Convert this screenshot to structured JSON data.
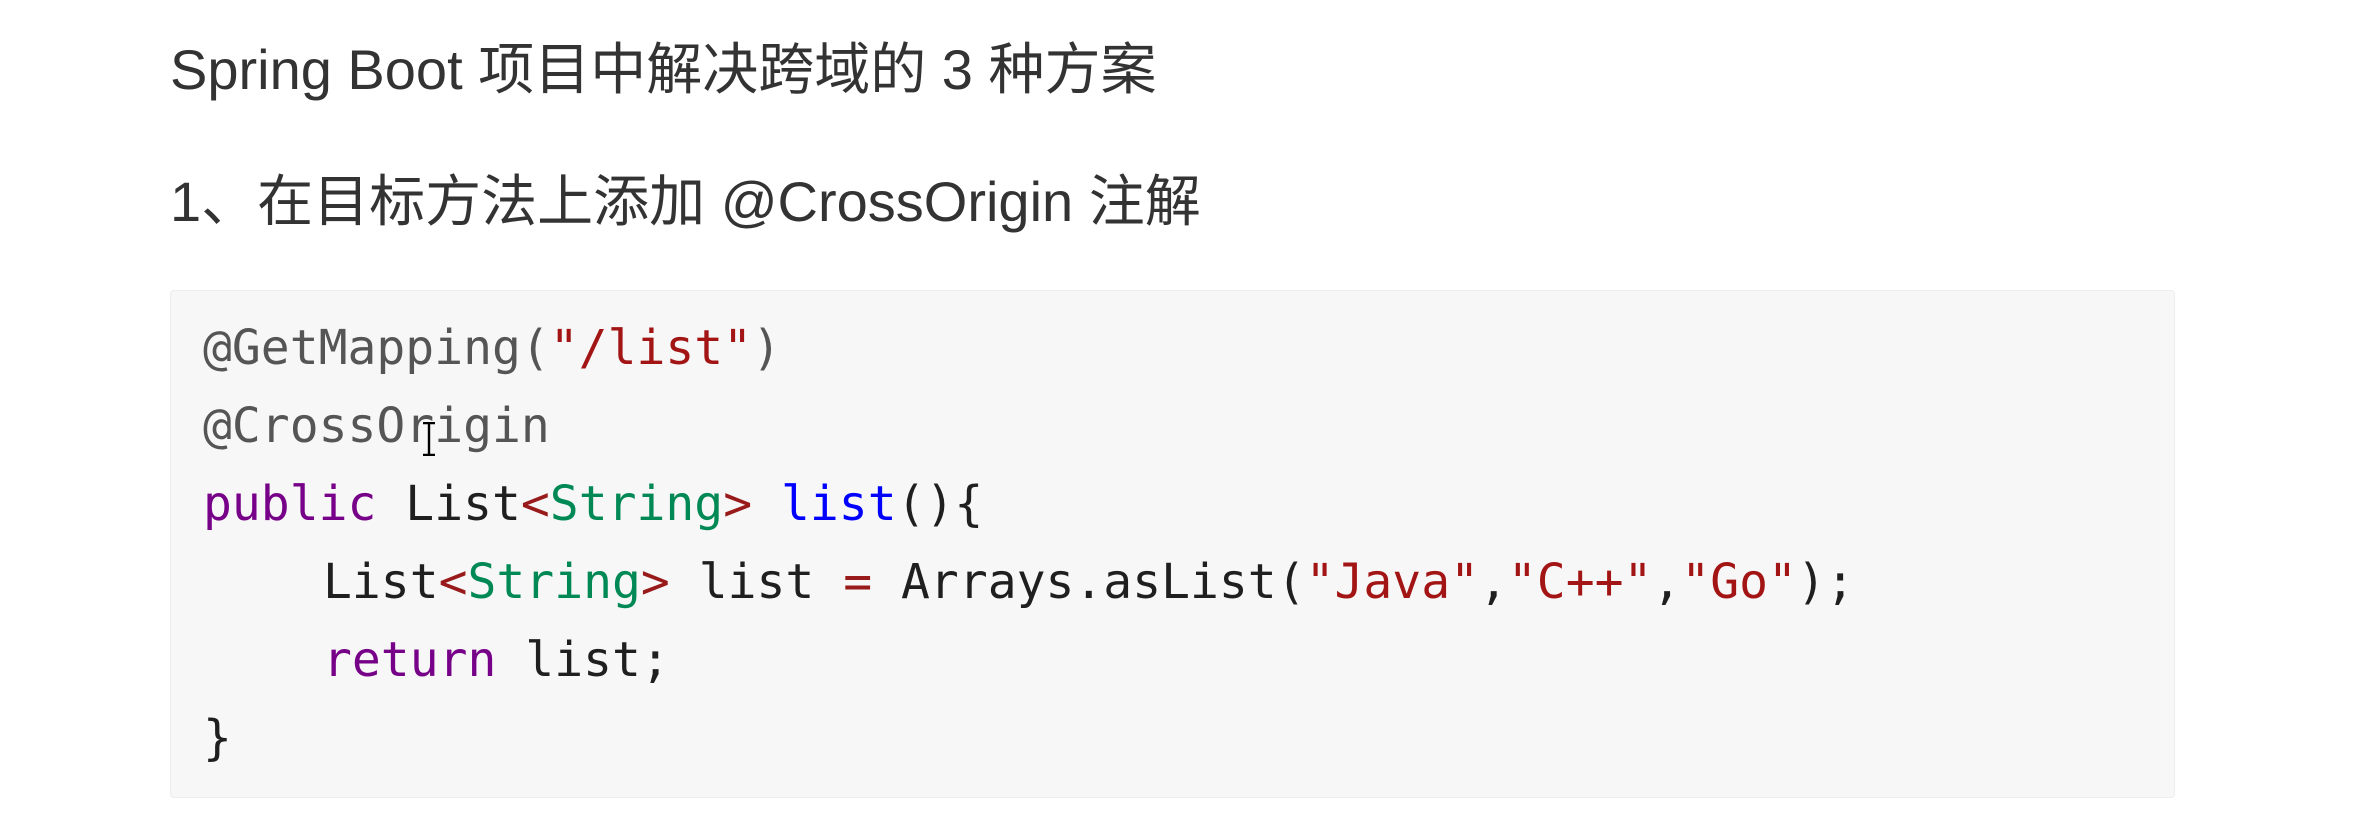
{
  "heading": {
    "title": "Spring Boot 项目中解决跨域的 3 种方案",
    "section": "1、在目标方法上添加 @CrossOrigin 注解"
  },
  "code": {
    "line1": {
      "annotation": "@GetMapping(",
      "string": "\"/list\"",
      "close": ")"
    },
    "line2": {
      "annotation": "@CrossOrigin"
    },
    "line3": {
      "keyword": "public",
      "type_name": "List",
      "generic_open": "<",
      "generic_type": "String",
      "generic_close": ">",
      "method": "list",
      "rest": "(){"
    },
    "line4": {
      "type_name": "List",
      "generic_open": "<",
      "generic_type": "String",
      "generic_close": ">",
      "var": "list",
      "op": "=",
      "call": "Arrays.asList(",
      "arg1": "\"Java\"",
      "comma1": ",",
      "arg2": "\"C++\"",
      "comma2": ",",
      "arg3": "\"Go\"",
      "end": ");"
    },
    "line5": {
      "keyword": "return",
      "rest": "list;"
    },
    "line6": {
      "brace": "}"
    }
  },
  "colors": {
    "background": "#ffffff",
    "code_background": "#f7f7f7",
    "string": "#a31515",
    "keyword": "#770088",
    "type": "#008855",
    "function": "#0000ff"
  },
  "icons": {
    "cursor": "i-beam-text-cursor-icon"
  }
}
